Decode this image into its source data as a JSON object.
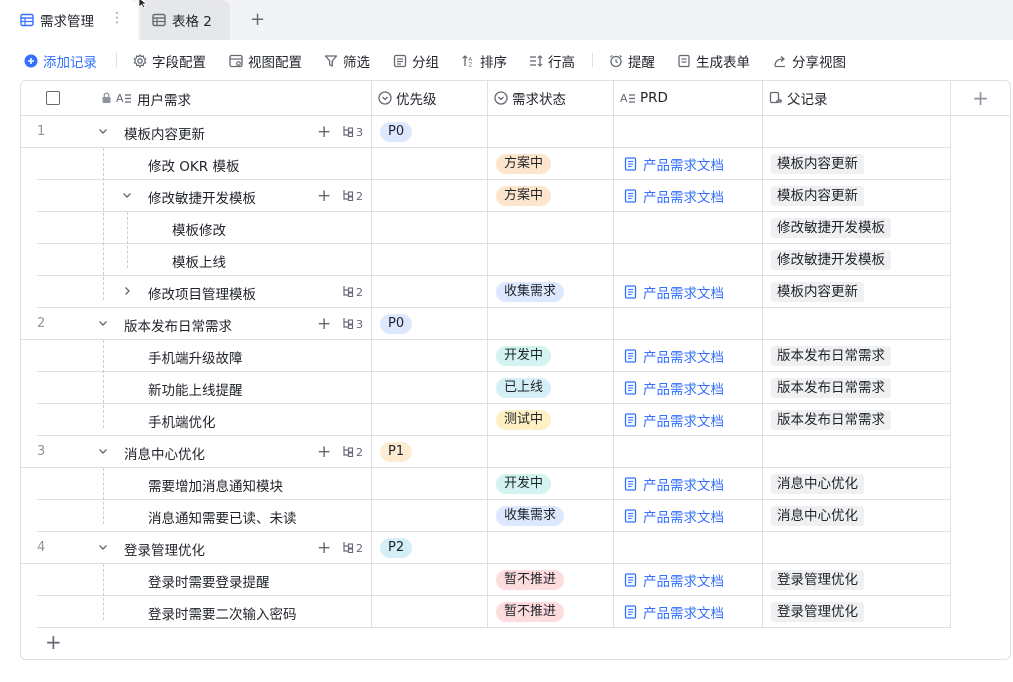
{
  "tabs": [
    {
      "label": "需求管理",
      "active": true
    },
    {
      "label": "表格 2",
      "active": false
    }
  ],
  "toolbar": {
    "add_record": "添加记录",
    "field_config": "字段配置",
    "view_config": "视图配置",
    "filter": "筛选",
    "group": "分组",
    "sort": "排序",
    "row_height": "行高",
    "reminder": "提醒",
    "generate_form": "生成表单",
    "share_view": "分享视图"
  },
  "columns": {
    "title": "用户需求",
    "priority": "优先级",
    "status": "需求状态",
    "prd": "PRD",
    "parent": "父记录"
  },
  "records": [
    {
      "num": "1",
      "level": 0,
      "title": "模板内容更新",
      "expanded": true,
      "subs": "3",
      "priority": "P0",
      "status": "",
      "prd": "",
      "parent": ""
    },
    {
      "num": "",
      "level": 1,
      "title": "修改 OKR 模板",
      "expanded": null,
      "subs": "",
      "priority": "",
      "status": "方案中",
      "prd": "产品需求文档",
      "parent": "模板内容更新"
    },
    {
      "num": "",
      "level": 1,
      "title": "修改敏捷开发模板",
      "expanded": true,
      "subs": "2",
      "priority": "",
      "status": "方案中",
      "prd": "产品需求文档",
      "parent": "模板内容更新"
    },
    {
      "num": "",
      "level": 2,
      "title": "模板修改",
      "expanded": null,
      "subs": "",
      "priority": "",
      "status": "",
      "prd": "",
      "parent": "修改敏捷开发模板"
    },
    {
      "num": "",
      "level": 2,
      "title": "模板上线",
      "expanded": null,
      "subs": "",
      "priority": "",
      "status": "",
      "prd": "",
      "parent": "修改敏捷开发模板"
    },
    {
      "num": "",
      "level": 1,
      "title": "修改项目管理模板",
      "expanded": false,
      "subs": "2",
      "priority": "",
      "status": "收集需求",
      "prd": "产品需求文档",
      "parent": "模板内容更新"
    },
    {
      "num": "2",
      "level": 0,
      "title": "版本发布日常需求",
      "expanded": true,
      "subs": "3",
      "priority": "P0",
      "status": "",
      "prd": "",
      "parent": ""
    },
    {
      "num": "",
      "level": 1,
      "title": "手机端升级故障",
      "expanded": null,
      "subs": "",
      "priority": "",
      "status": "开发中",
      "prd": "产品需求文档",
      "parent": "版本发布日常需求"
    },
    {
      "num": "",
      "level": 1,
      "title": "新功能上线提醒",
      "expanded": null,
      "subs": "",
      "priority": "",
      "status": "已上线",
      "prd": "产品需求文档",
      "parent": "版本发布日常需求"
    },
    {
      "num": "",
      "level": 1,
      "title": "手机端优化",
      "expanded": null,
      "subs": "",
      "priority": "",
      "status": "测试中",
      "prd": "产品需求文档",
      "parent": "版本发布日常需求"
    },
    {
      "num": "3",
      "level": 0,
      "title": "消息中心优化",
      "expanded": true,
      "subs": "2",
      "priority": "P1",
      "status": "",
      "prd": "",
      "parent": ""
    },
    {
      "num": "",
      "level": 1,
      "title": "需要增加消息通知模块",
      "expanded": null,
      "subs": "",
      "priority": "",
      "status": "开发中",
      "prd": "产品需求文档",
      "parent": "消息中心优化"
    },
    {
      "num": "",
      "level": 1,
      "title": "消息通知需要已读、未读",
      "expanded": null,
      "subs": "",
      "priority": "",
      "status": "收集需求",
      "prd": "产品需求文档",
      "parent": "消息中心优化"
    },
    {
      "num": "4",
      "level": 0,
      "title": "登录管理优化",
      "expanded": true,
      "subs": "2",
      "priority": "P2",
      "status": "",
      "prd": "",
      "parent": ""
    },
    {
      "num": "",
      "level": 1,
      "title": "登录时需要登录提醒",
      "expanded": null,
      "subs": "",
      "priority": "",
      "status": "暂不推进",
      "prd": "产品需求文档",
      "parent": "登录管理优化"
    },
    {
      "num": "",
      "level": 1,
      "title": "登录时需要二次输入密码",
      "expanded": null,
      "subs": "",
      "priority": "",
      "status": "暂不推进",
      "prd": "产品需求文档",
      "parent": "登录管理优化"
    }
  ],
  "status_colors": {
    "方案中": {
      "bg": "#fde5cd",
      "fg": "#1f2329"
    },
    "收集需求": {
      "bg": "#dde8fe",
      "fg": "#1f2329"
    },
    "开发中": {
      "bg": "#d2f3f0",
      "fg": "#1f2329"
    },
    "已上线": {
      "bg": "#d5eff7",
      "fg": "#1f2329"
    },
    "测试中": {
      "bg": "#fdf0c4",
      "fg": "#1f2329"
    },
    "暂不推进": {
      "bg": "#fcdcdc",
      "fg": "#1f2329"
    }
  },
  "icons": {
    "tab_active": "table-icon",
    "tab_inactive": "table-icon",
    "add_record": "plus-circle-icon",
    "field_config": "gear-icon",
    "view_config": "view-config-icon",
    "filter": "funnel-icon",
    "group": "group-icon",
    "sort": "sort-icon",
    "row_height": "row-height-icon",
    "reminder": "alarm-clock-icon",
    "generate_form": "form-icon",
    "share_view": "share-icon"
  },
  "accent_color": "#3370ff"
}
